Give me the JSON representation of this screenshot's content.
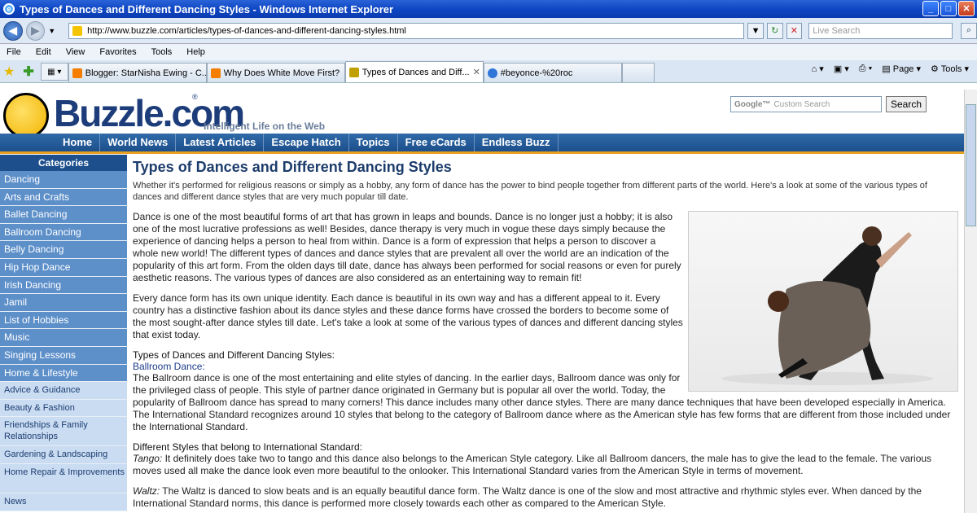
{
  "window": {
    "title": "Types of Dances and Different Dancing Styles - Windows Internet Explorer",
    "url": "http://www.buzzle.com/articles/types-of-dances-and-different-dancing-styles.html",
    "live_search_placeholder": "Live Search"
  },
  "menu": [
    "File",
    "Edit",
    "View",
    "Favorites",
    "Tools",
    "Help"
  ],
  "tabs": [
    {
      "label": "Blogger: StarNisha Ewing - C..."
    },
    {
      "label": "Why Does White Move First?"
    },
    {
      "label": "Types of Dances and Diff..."
    },
    {
      "label": "#beyonce-%20roc"
    }
  ],
  "toolbar_right": {
    "page": "Page",
    "tools": "Tools"
  },
  "site": {
    "logo": "Buzzle.com",
    "reg": "®",
    "tagline": "Intelligent Life on the Web",
    "search_placeholder": "Custom Search",
    "search_button": "Search",
    "nav": [
      "Home",
      "World News",
      "Latest Articles",
      "Escape Hatch",
      "Topics",
      "Free eCards",
      "Endless Buzz"
    ]
  },
  "sidebar": {
    "title": "Categories",
    "items": [
      "Dancing",
      "Arts and Crafts",
      "Ballet Dancing",
      "Ballroom Dancing",
      "Belly Dancing",
      "Hip Hop Dance",
      "Irish Dancing",
      "Jamil",
      "List of Hobbies",
      "Music",
      "Singing Lessons",
      "Home & Lifestyle"
    ],
    "light_items": [
      "Advice & Guidance",
      "Beauty & Fashion",
      "Friendships & Family Relationships",
      "Gardening & Landscaping",
      "Home Repair & Improvements",
      "News"
    ]
  },
  "article": {
    "title": "Types of Dances and Different Dancing Styles",
    "intro": "Whether it's performed for religious reasons or simply as a hobby, any form of dance has the power to bind people together from different parts of the world. Here's a look at some of the various types of dances and different dance styles that are very much popular till date.",
    "p1": "Dance is one of the most beautiful forms of art that has grown in leaps and bounds. Dance is no longer just a hobby; it is also one of the most lucrative professions as well! Besides, dance therapy is very much in vogue these days simply because the experience of dancing helps a person to heal from within. Dance is a form of expression that helps a person to discover a whole new world! The different types of dances and dance styles that are prevalent all over the world are an indication of the popularity of this art form. From the olden days till date, dance has always been performed for social reasons or even for purely aesthetic reasons. The various types of dances are also considered as an entertaining way to remain fit!",
    "p2": "Every dance form has its own unique identity. Each dance is beautiful in its own way and has a different appeal to it. Every country has a distinctive fashion about its dance styles and these dance forms have crossed the borders to become some of the most sought-after dance styles till date. Let's take a look at some of the various types of dances and different dancing styles that exist today.",
    "sub1": "Types of Dances and Different Dancing Styles:",
    "sub1_link": "Ballroom Dance:",
    "p3": "The Ballroom dance is one of the most entertaining and elite styles of dancing. In the earlier days, Ballroom dance was only for the privileged class of people. This style of partner dance originated in Germany but is popular all over the world. Today, the popularity of Ballroom dance has spread to many corners! This dance includes many other dance styles. There are many dance techniques that have been developed especially in America. The International Standard recognizes around 10 styles that belong to the category of Ballroom dance where as the American style has few forms that are different from those included under the International Standard.",
    "sub2": "Different Styles that belong to International Standard:",
    "p4_label": "Tango:",
    "p4": " It definitely does take two to tango and this dance also belongs to the American Style category. Like all Ballroom dancers, the male has to give the lead to the female. The various moves used all make the dance look even more beautiful to the onlooker. This International Standard varies from the American Style in terms of movement.",
    "p5_label": "Waltz:",
    "p5": " The Waltz is danced to slow beats and is an equally beautiful dance form. The Waltz dance is one of the slow and most attractive and rhythmic styles ever. When danced by the International Standard norms, this dance is performed more closely towards each other as compared to the American Style."
  }
}
